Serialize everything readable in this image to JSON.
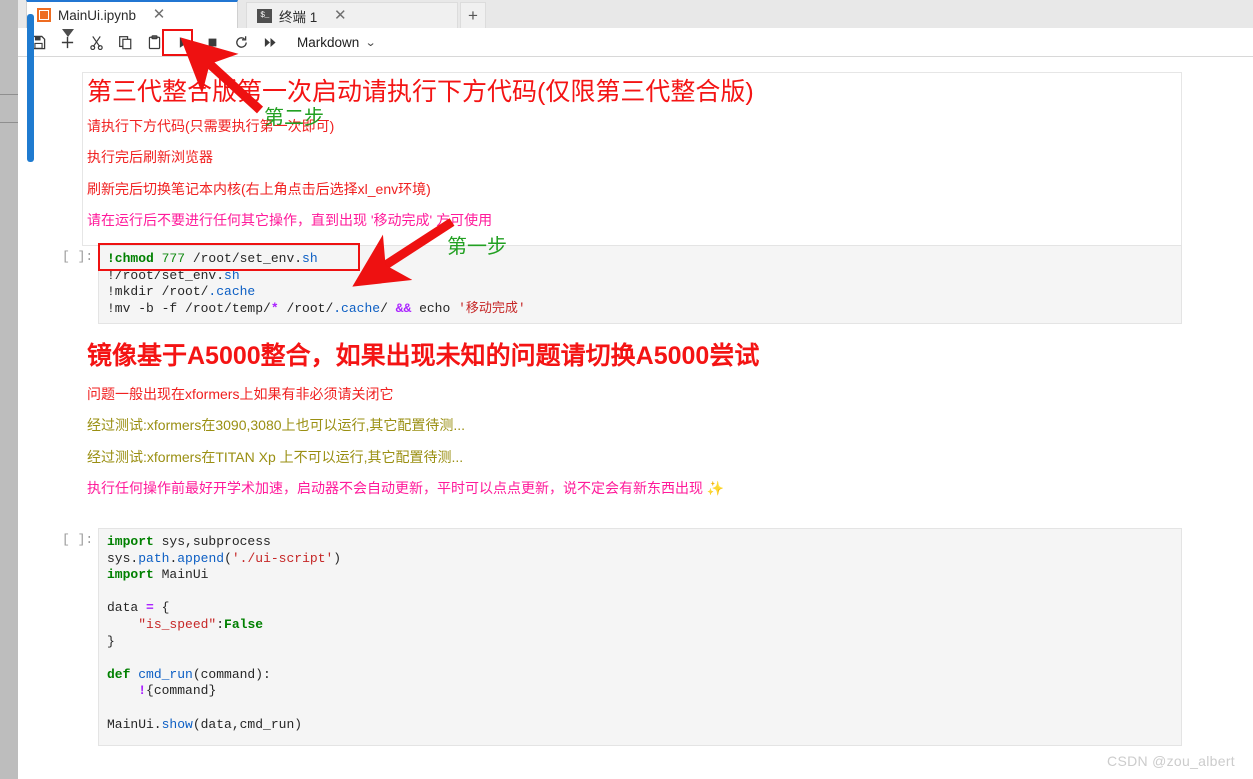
{
  "window": {
    "tabs": [
      {
        "label": "MainUi.ipynb",
        "icon": "notebook-icon",
        "active": true,
        "close": "✕"
      },
      {
        "label": "终端 1",
        "icon": "terminal-icon",
        "active": false,
        "close": "✕"
      }
    ],
    "add_tab_label": "+"
  },
  "toolbar": {
    "buttons": [
      {
        "name": "save-button",
        "title": "Save"
      },
      {
        "name": "insert-cell-button",
        "title": "Insert cell below"
      },
      {
        "name": "cut-button",
        "title": "Cut cells"
      },
      {
        "name": "copy-button",
        "title": "Copy cells"
      },
      {
        "name": "paste-button",
        "title": "Paste cells"
      },
      {
        "name": "run-button",
        "title": "Run"
      },
      {
        "name": "stop-button",
        "title": "Interrupt kernel"
      },
      {
        "name": "restart-button",
        "title": "Restart kernel"
      },
      {
        "name": "restart-run-all-button",
        "title": "Restart and run all"
      }
    ],
    "cell_type": "Markdown",
    "cell_type_chevron": "⌄"
  },
  "markdown_cell_1": {
    "heading": "第三代整合版第一次启动请执行下方代码(仅限第三代整合版)",
    "lines": [
      {
        "text": "请执行下方代码(只需要执行第一次即可)",
        "color": "red"
      },
      {
        "text": "执行完后刷新浏览器",
        "color": "red"
      },
      {
        "text": "刷新完后切换笔记本内核(右上角点击后选择xl_env环境)",
        "color": "red"
      },
      {
        "text": "请在运行后不要进行任何其它操作，直到出现 '移动完成' 方可使用",
        "color": "pink"
      }
    ]
  },
  "code_cell_1": {
    "prompt": "[ ]:",
    "lines": [
      [
        {
          "t": "!chmod ",
          "c": "green-bold"
        },
        {
          "t": "777 ",
          "c": "num"
        },
        {
          "t": "/root/set_env.",
          "c": "plain"
        },
        {
          "t": "sh",
          "c": "blue"
        }
      ],
      [
        {
          "t": "!/root/set_env.",
          "c": "plain"
        },
        {
          "t": "sh",
          "c": "blue"
        }
      ],
      [
        {
          "t": "!mkdir /root/",
          "c": "plain"
        },
        {
          "t": ".cache",
          "c": "blue"
        }
      ],
      [
        {
          "t": "!mv -b -f /root/temp/",
          "c": "plain"
        },
        {
          "t": "*",
          "c": "op"
        },
        {
          "t": " /root/",
          "c": "plain"
        },
        {
          "t": ".cache",
          "c": "blue"
        },
        {
          "t": "/ ",
          "c": "plain"
        },
        {
          "t": "&&",
          "c": "op"
        },
        {
          "t": " echo ",
          "c": "plain"
        },
        {
          "t": "'移动完成'",
          "c": "str"
        }
      ]
    ]
  },
  "markdown_cell_2": {
    "heading": "镜像基于A5000整合，如果出现未知的问题请切换A5000尝试",
    "lines": [
      {
        "text": "问题一般出现在xformers上如果有非必须请关闭它",
        "color": "red"
      },
      {
        "text": "经过测试:xformers在3090,3080上也可以运行,其它配置待测...",
        "color": "olive"
      },
      {
        "text": "经过测试:xformers在TITAN Xp 上不可以运行,其它配置待测...",
        "color": "olive"
      },
      {
        "text": "执行任何操作前最好开学术加速，启动器不会自动更新，平时可以点点更新，说不定会有新东西出现 ✨",
        "color": "pink"
      }
    ]
  },
  "code_cell_2": {
    "prompt": "[ ]:",
    "lines": [
      [
        {
          "t": "import",
          "c": "green-bold"
        },
        {
          "t": " sys,subprocess",
          "c": "plain"
        }
      ],
      [
        {
          "t": "sys.",
          "c": "plain"
        },
        {
          "t": "path",
          "c": "blue"
        },
        {
          "t": ".",
          "c": "plain"
        },
        {
          "t": "append",
          "c": "blue"
        },
        {
          "t": "(",
          "c": "plain"
        },
        {
          "t": "'./ui-script'",
          "c": "str"
        },
        {
          "t": ")",
          "c": "plain"
        }
      ],
      [
        {
          "t": "import",
          "c": "green-bold"
        },
        {
          "t": " MainUi",
          "c": "plain"
        }
      ],
      [
        {
          "t": "",
          "c": "plain"
        }
      ],
      [
        {
          "t": "data ",
          "c": "plain"
        },
        {
          "t": "=",
          "c": "op"
        },
        {
          "t": " {",
          "c": "plain"
        }
      ],
      [
        {
          "t": "    ",
          "c": "plain"
        },
        {
          "t": "\"is_speed\"",
          "c": "str"
        },
        {
          "t": ":",
          "c": "plain"
        },
        {
          "t": "False",
          "c": "green-bold"
        }
      ],
      [
        {
          "t": "}",
          "c": "plain"
        }
      ],
      [
        {
          "t": "",
          "c": "plain"
        }
      ],
      [
        {
          "t": "def",
          "c": "green-bold"
        },
        {
          "t": " ",
          "c": "plain"
        },
        {
          "t": "cmd_run",
          "c": "blue"
        },
        {
          "t": "(command):",
          "c": "plain"
        }
      ],
      [
        {
          "t": "    ",
          "c": "plain"
        },
        {
          "t": "!",
          "c": "op"
        },
        {
          "t": "{command}",
          "c": "plain"
        }
      ],
      [
        {
          "t": "",
          "c": "plain"
        }
      ],
      [
        {
          "t": "MainUi.",
          "c": "plain"
        },
        {
          "t": "show",
          "c": "blue"
        },
        {
          "t": "(data,cmd_run)",
          "c": "plain"
        }
      ]
    ]
  },
  "annotations": {
    "step_two": "第二步",
    "step_one": "第一步",
    "arrow_color": "#ee1111",
    "green_color": "#22a022"
  },
  "watermark": "CSDN @zou_albert"
}
